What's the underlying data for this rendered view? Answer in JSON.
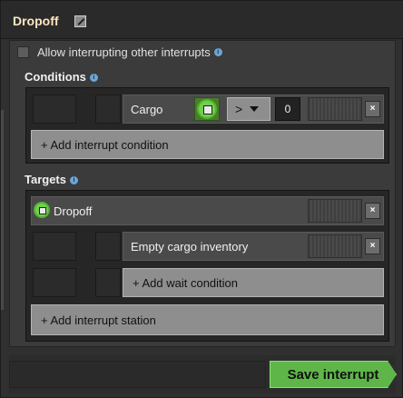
{
  "window": {
    "title": "Dropoff"
  },
  "options": {
    "allow_interrupting_label": "Allow interrupting other interrupts",
    "allow_interrupting_checked": false
  },
  "conditions": {
    "label": "Conditions",
    "items": [
      {
        "type": "Cargo",
        "comparator": ">",
        "value": "0",
        "close_label": "×"
      }
    ],
    "add_label": "+ Add interrupt condition"
  },
  "targets": {
    "label": "Targets",
    "stations": [
      {
        "name": "Dropoff",
        "close_label": "×",
        "wait_conditions": [
          {
            "label": "Empty cargo inventory",
            "close_label": "×"
          }
        ],
        "add_wait_label": "+ Add wait condition"
      }
    ],
    "add_station_label": "+ Add interrupt station"
  },
  "footer": {
    "save_label": "Save interrupt"
  },
  "colors": {
    "accent_green": "#5eb649",
    "title_color": "#ffe6c0",
    "info_blue": "#6aa7d8"
  },
  "icons": {
    "edit": "pencil-icon",
    "info": "info-icon",
    "station": "train-stop-icon",
    "condition": "cargo-icon",
    "close": "close-icon",
    "dropdown": "chevron-down-icon"
  }
}
